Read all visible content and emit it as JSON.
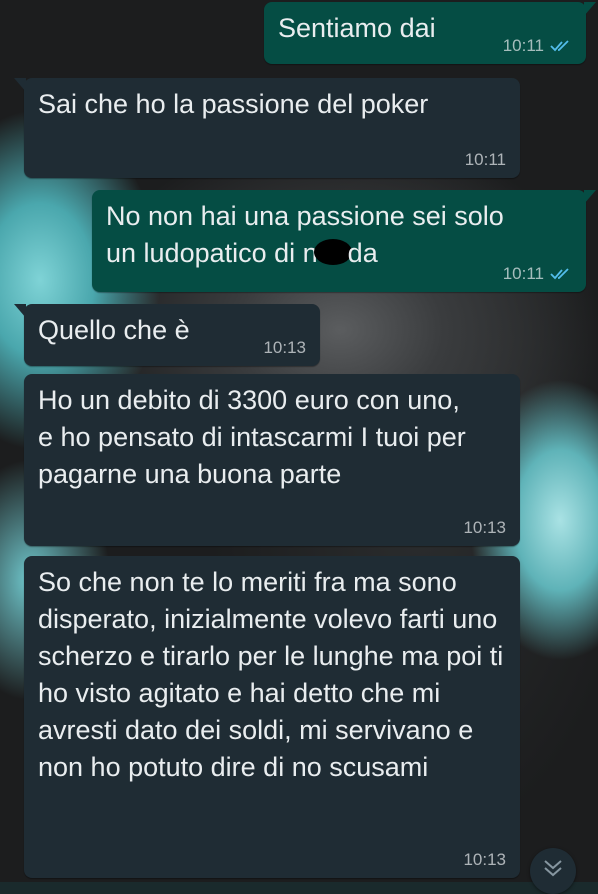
{
  "chat": {
    "messages": [
      {
        "dir": "out",
        "text": "Sentiamo dai",
        "time": "10:11",
        "read": true
      },
      {
        "dir": "in",
        "text": "Sai che ho la passione del poker",
        "time": "10:11"
      },
      {
        "dir": "out",
        "line1": "No non hai una passione sei solo",
        "line2_a": "un  ludopatico di n",
        "line2_b": "da",
        "time": "10:11",
        "read": true
      },
      {
        "dir": "in",
        "text": "Quello che è",
        "time": "10:13"
      },
      {
        "dir": "in",
        "text": "Ho un debito di 3300 euro con uno, e ho pensato di intascarmi I tuoi per pagarne una buona parte",
        "time": "10:13"
      },
      {
        "dir": "in",
        "text": "So che non te lo meriti fra ma sono disperato, inizialmente volevo farti uno scherzo e tirarlo per le lunghe ma poi ti ho visto agitato e hai detto che mi avresti dato dei soldi, mi servivano e non ho potuto dire di no scusami",
        "time": "10:13"
      }
    ]
  },
  "colors": {
    "outgoing_bubble": "#054d44",
    "incoming_bubble": "#1f2c34",
    "read_ticks": "#53bdeb"
  },
  "icons": {
    "read_receipt": "double-check-icon",
    "scroll_down": "double-chevron-down-icon"
  }
}
